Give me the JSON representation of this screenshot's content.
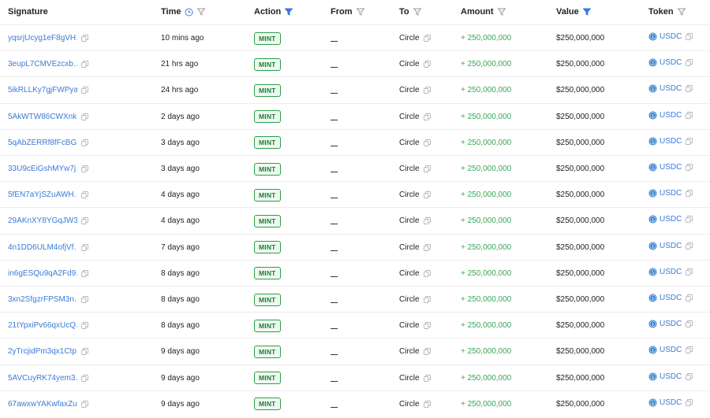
{
  "header": {
    "signature": "Signature",
    "time": "Time",
    "action": "Action",
    "from": "From",
    "to": "To",
    "amount": "Amount",
    "value": "Value",
    "token": "Token"
  },
  "colors": {
    "link": "#3a7bd5",
    "amount_green": "#3aa655",
    "badge_border": "#2e9e4b",
    "filter_active": "#3a7bd5",
    "filter_inactive": "#9a9a9a"
  },
  "icons": {
    "time_header": "clock-icon",
    "filter": "filter-icon",
    "copy": "copy-icon",
    "token": "usdc-coin-icon"
  },
  "rows": [
    {
      "signature": "yqsrjUcyg1eF8gVH…",
      "time": "10 mins ago",
      "action": "MINT",
      "from": "",
      "to": "Circle",
      "amount": "+ 250,000,000",
      "value": "$250,000,000",
      "token": "USDC"
    },
    {
      "signature": "3eupL7CMVEzcxb…",
      "time": "21 hrs ago",
      "action": "MINT",
      "from": "",
      "to": "Circle",
      "amount": "+ 250,000,000",
      "value": "$250,000,000",
      "token": "USDC"
    },
    {
      "signature": "5ikRLLKy7gjFWPya…",
      "time": "24 hrs ago",
      "action": "MINT",
      "from": "",
      "to": "Circle",
      "amount": "+ 250,000,000",
      "value": "$250,000,000",
      "token": "USDC"
    },
    {
      "signature": "5AkWTW86CWXnk…",
      "time": "2 days ago",
      "action": "MINT",
      "from": "",
      "to": "Circle",
      "amount": "+ 250,000,000",
      "value": "$250,000,000",
      "token": "USDC"
    },
    {
      "signature": "5qAbZERRf8fFcBG…",
      "time": "3 days ago",
      "action": "MINT",
      "from": "",
      "to": "Circle",
      "amount": "+ 250,000,000",
      "value": "$250,000,000",
      "token": "USDC"
    },
    {
      "signature": "33U9cEiGshMYw7j…",
      "time": "3 days ago",
      "action": "MINT",
      "from": "",
      "to": "Circle",
      "amount": "+ 250,000,000",
      "value": "$250,000,000",
      "token": "USDC"
    },
    {
      "signature": "5fEN7aYjSZuAWH…",
      "time": "4 days ago",
      "action": "MINT",
      "from": "",
      "to": "Circle",
      "amount": "+ 250,000,000",
      "value": "$250,000,000",
      "token": "USDC"
    },
    {
      "signature": "29AKnXY8YGqJW3…",
      "time": "4 days ago",
      "action": "MINT",
      "from": "",
      "to": "Circle",
      "amount": "+ 250,000,000",
      "value": "$250,000,000",
      "token": "USDC"
    },
    {
      "signature": "4n1DD6ULM4ofjVf…",
      "time": "7 days ago",
      "action": "MINT",
      "from": "",
      "to": "Circle",
      "amount": "+ 250,000,000",
      "value": "$250,000,000",
      "token": "USDC"
    },
    {
      "signature": "in6gESQu9qA2Fd9…",
      "time": "8 days ago",
      "action": "MINT",
      "from": "",
      "to": "Circle",
      "amount": "+ 250,000,000",
      "value": "$250,000,000",
      "token": "USDC"
    },
    {
      "signature": "3xn2SfgzrFPSM3n…",
      "time": "8 days ago",
      "action": "MINT",
      "from": "",
      "to": "Circle",
      "amount": "+ 250,000,000",
      "value": "$250,000,000",
      "token": "USDC"
    },
    {
      "signature": "21tYpxiPv66qxUcQ…",
      "time": "8 days ago",
      "action": "MINT",
      "from": "",
      "to": "Circle",
      "amount": "+ 250,000,000",
      "value": "$250,000,000",
      "token": "USDC"
    },
    {
      "signature": "2yTrcjidPm3qx1Ctp…",
      "time": "9 days ago",
      "action": "MINT",
      "from": "",
      "to": "Circle",
      "amount": "+ 250,000,000",
      "value": "$250,000,000",
      "token": "USDC"
    },
    {
      "signature": "5AVCuyRK74yem3…",
      "time": "9 days ago",
      "action": "MINT",
      "from": "",
      "to": "Circle",
      "amount": "+ 250,000,000",
      "value": "$250,000,000",
      "token": "USDC"
    },
    {
      "signature": "67awxwYAKwfaxZu…",
      "time": "9 days ago",
      "action": "MINT",
      "from": "",
      "to": "Circle",
      "amount": "+ 250,000,000",
      "value": "$250,000,000",
      "token": "USDC"
    }
  ]
}
